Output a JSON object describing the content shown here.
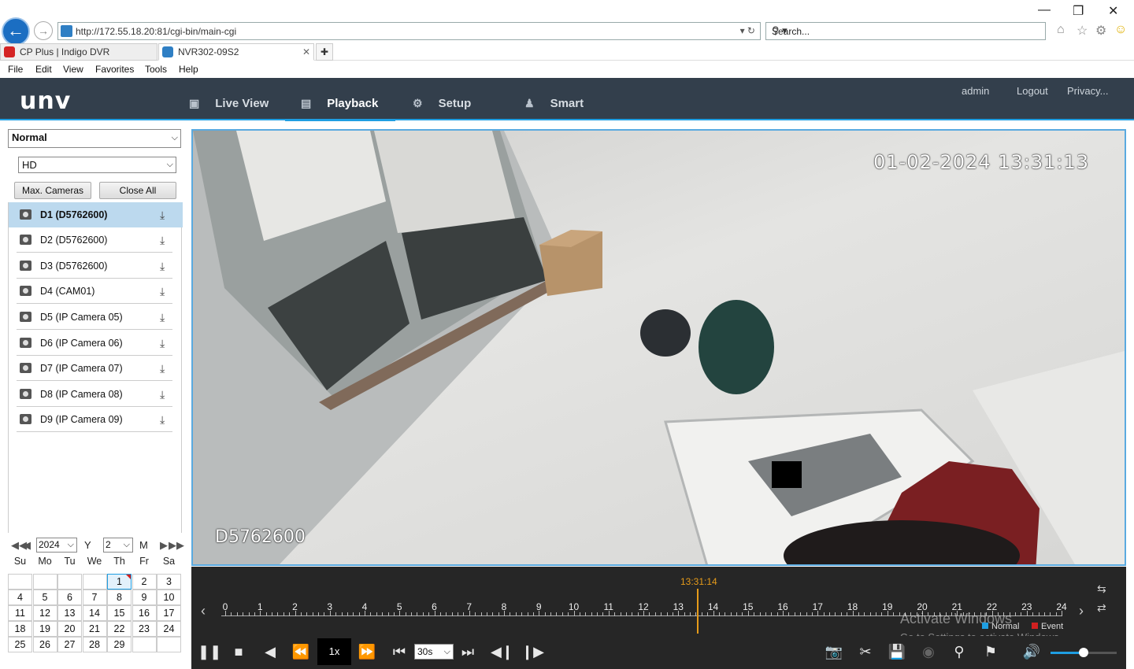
{
  "browser": {
    "url": "http://172.55.18.20:81/cgi-bin/main-cgi",
    "search_placeholder": "Search...",
    "tabs": [
      {
        "title": "CP Plus | Indigo DVR",
        "active": false
      },
      {
        "title": "NVR302-09S2",
        "active": true
      }
    ],
    "menu": [
      "File",
      "Edit",
      "View",
      "Favorites",
      "Tools",
      "Help"
    ]
  },
  "header": {
    "logo": "unv",
    "nav": [
      {
        "label": "Live View",
        "active": false
      },
      {
        "label": "Playback",
        "active": true
      },
      {
        "label": "Setup",
        "active": false
      },
      {
        "label": "Smart",
        "active": false
      }
    ],
    "links": {
      "user": "admin",
      "logout": "Logout",
      "privacy": "Privacy..."
    }
  },
  "sidebar": {
    "mode": "Normal",
    "stream": "HD",
    "max_cameras": "Max. Cameras",
    "close_all": "Close All",
    "cameras": [
      {
        "label": "D1 (D5762600)",
        "selected": true
      },
      {
        "label": "D2 (D5762600)",
        "selected": false
      },
      {
        "label": "D3 (D5762600)",
        "selected": false
      },
      {
        "label": "D4 (CAM01)",
        "selected": false
      },
      {
        "label": "D5 (IP Camera 05)",
        "selected": false
      },
      {
        "label": "D6 (IP Camera 06)",
        "selected": false
      },
      {
        "label": "D7 (IP Camera 07)",
        "selected": false
      },
      {
        "label": "D8 (IP Camera 08)",
        "selected": false
      },
      {
        "label": "D9 (IP Camera 09)",
        "selected": false
      }
    ]
  },
  "calendar": {
    "year": "2024",
    "year_label": "Y",
    "month": "2",
    "month_label": "M",
    "weekdays": [
      "Su",
      "Mo",
      "Tu",
      "We",
      "Th",
      "Fr",
      "Sa"
    ],
    "weeks": [
      [
        "",
        "",
        "",
        "",
        "1",
        "2",
        "3"
      ],
      [
        "4",
        "5",
        "6",
        "7",
        "8",
        "9",
        "10"
      ],
      [
        "11",
        "12",
        "13",
        "14",
        "15",
        "16",
        "17"
      ],
      [
        "18",
        "19",
        "20",
        "21",
        "22",
        "23",
        "24"
      ],
      [
        "25",
        "26",
        "27",
        "28",
        "29",
        "",
        ""
      ]
    ],
    "selected_day": "1"
  },
  "video": {
    "osd_time": "01-02-2024 13:31:13",
    "osd_name": "D5762600"
  },
  "timeline": {
    "current_time": "13:31:14",
    "hours": [
      "0",
      "1",
      "2",
      "3",
      "4",
      "5",
      "6",
      "7",
      "8",
      "9",
      "10",
      "11",
      "12",
      "13",
      "14",
      "15",
      "16",
      "17",
      "18",
      "19",
      "20",
      "21",
      "22",
      "23",
      "24"
    ],
    "legend_normal": "Normal",
    "legend_event": "Event",
    "watermark_line1": "Activate Windows",
    "watermark_line2": "Go to Settings to activate Windows.",
    "colors": {
      "normal": "#1f9ee2",
      "event": "#d02020",
      "cursor": "#e69b1a"
    }
  },
  "controls": {
    "speed": "1x",
    "interval": "30s",
    "volume_fraction": 0.5
  }
}
